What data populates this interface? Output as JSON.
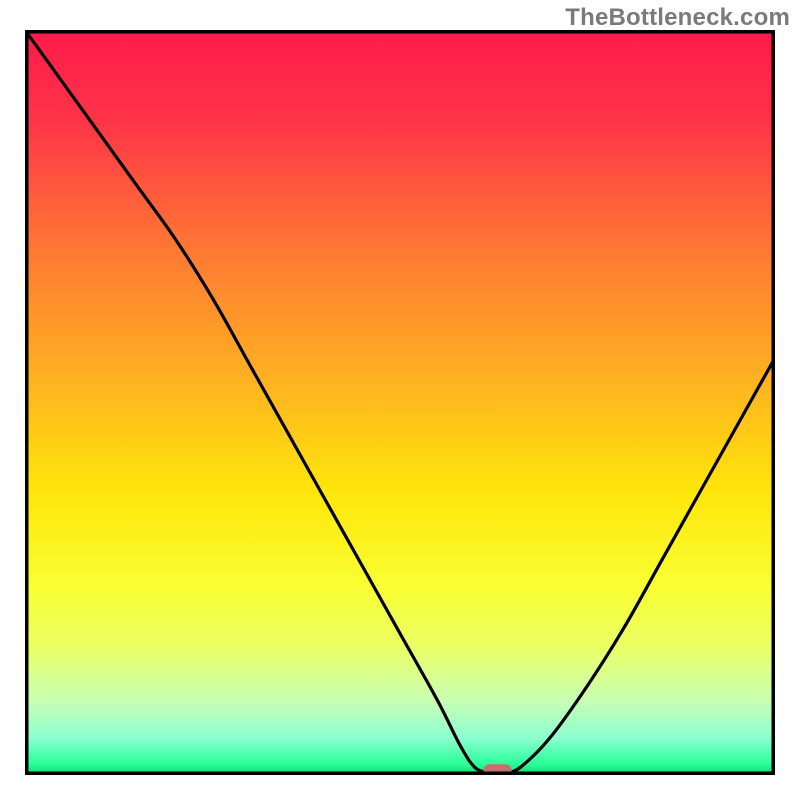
{
  "watermark": "TheBottleneck.com",
  "chart_data": {
    "type": "line",
    "title": "",
    "xlabel": "",
    "ylabel": "",
    "xlim": [
      0,
      100
    ],
    "ylim": [
      0,
      100
    ],
    "grid": false,
    "series": [
      {
        "name": "bottleneck-curve",
        "x": [
          0,
          5,
          10,
          15,
          20,
          25,
          30,
          35,
          40,
          45,
          50,
          55,
          58,
          60,
          62,
          64,
          66,
          70,
          75,
          80,
          85,
          90,
          95,
          100
        ],
        "y": [
          100,
          93,
          86,
          79,
          72,
          64,
          55,
          46,
          37,
          28,
          19,
          10,
          4,
          1,
          0.3,
          0.3,
          1,
          5,
          12,
          20,
          29,
          38,
          47,
          56
        ]
      }
    ],
    "marker": {
      "x": 63,
      "y": 0.5,
      "color": "#c86e6e"
    },
    "background_gradient": {
      "stops": [
        {
          "offset": 0.0,
          "color": "#ff1a4b"
        },
        {
          "offset": 0.12,
          "color": "#ff3348"
        },
        {
          "offset": 0.3,
          "color": "#ff7a33"
        },
        {
          "offset": 0.48,
          "color": "#ffb51f"
        },
        {
          "offset": 0.62,
          "color": "#ffe60a"
        },
        {
          "offset": 0.75,
          "color": "#f8ff33"
        },
        {
          "offset": 0.83,
          "color": "#eaff66"
        },
        {
          "offset": 0.9,
          "color": "#c8ffb3"
        },
        {
          "offset": 0.95,
          "color": "#8cffd0"
        },
        {
          "offset": 0.985,
          "color": "#2bff9a"
        },
        {
          "offset": 1.0,
          "color": "#0bd66b"
        }
      ]
    },
    "frame_color": "#000000",
    "line_color": "#000000"
  }
}
